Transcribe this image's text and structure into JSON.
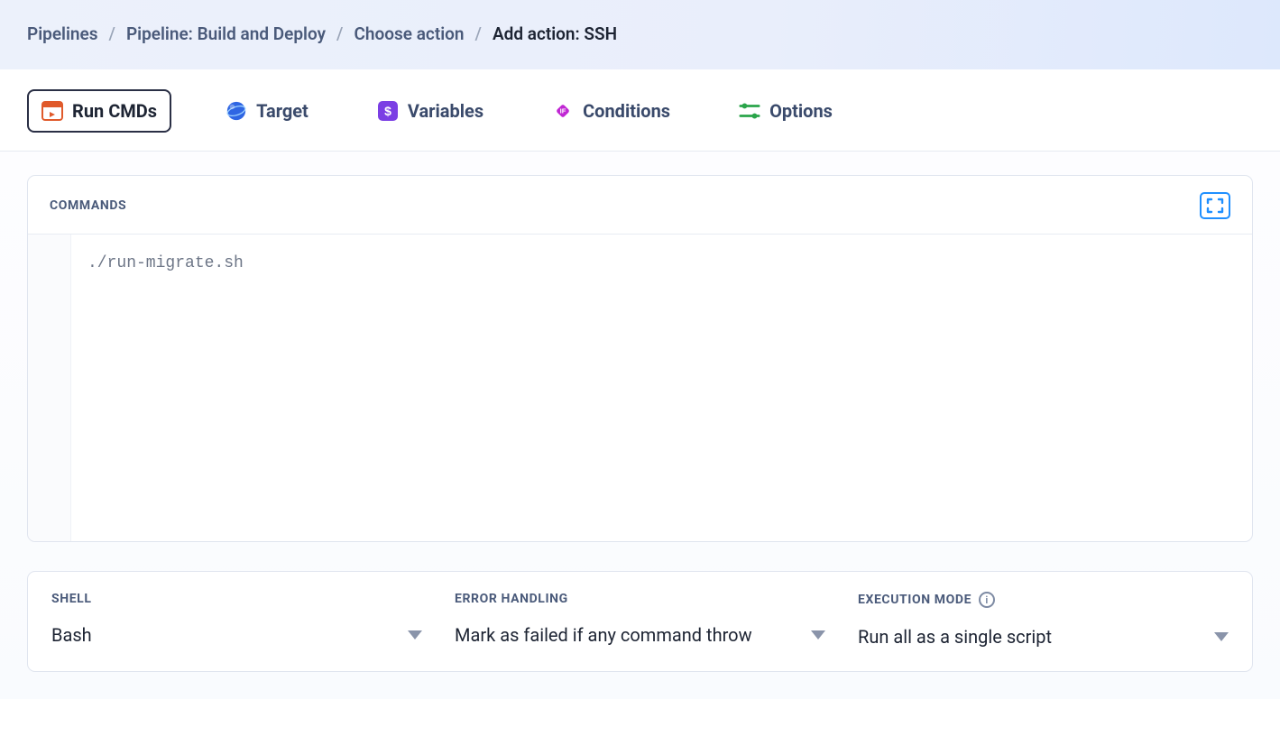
{
  "breadcrumb": {
    "items": [
      "Pipelines",
      "Pipeline: Build and Deploy",
      "Choose action"
    ],
    "current": "Add action: SSH"
  },
  "tabs": [
    {
      "label": "Run CMDs",
      "icon": "terminal-icon",
      "active": true
    },
    {
      "label": "Target",
      "icon": "globe-icon",
      "active": false
    },
    {
      "label": "Variables",
      "icon": "dollar-icon",
      "active": false
    },
    {
      "label": "Conditions",
      "icon": "diamond-icon",
      "active": false
    },
    {
      "label": "Options",
      "icon": "sliders-icon",
      "active": false
    }
  ],
  "commands": {
    "label": "COMMANDS",
    "code": "./run-migrate.sh"
  },
  "fields": {
    "shell": {
      "label": "SHELL",
      "value": "Bash"
    },
    "error": {
      "label": "ERROR HANDLING",
      "value": "Mark as failed if any command throw"
    },
    "exec": {
      "label": "EXECUTION MODE",
      "value": "Run all as a single script"
    }
  }
}
